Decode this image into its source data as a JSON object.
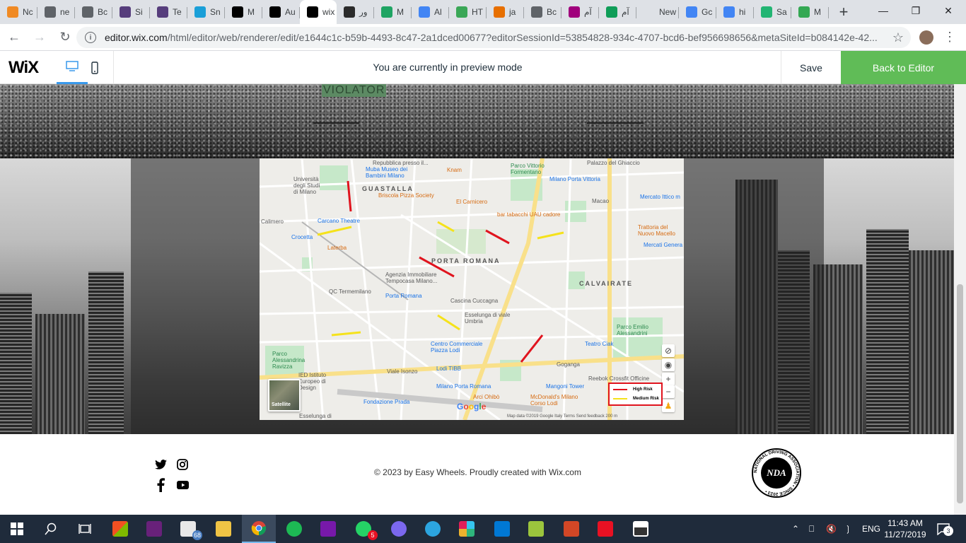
{
  "browser": {
    "tabs": [
      {
        "label": "Nc",
        "color": "#f08a24"
      },
      {
        "label": "ne",
        "color": "#5f6368"
      },
      {
        "label": "Bc",
        "color": "#5f6368"
      },
      {
        "label": "Si",
        "color": "#563d7c"
      },
      {
        "label": "Te",
        "color": "#563d7c"
      },
      {
        "label": "Sn",
        "color": "#1a9fd8"
      },
      {
        "label": "M",
        "color": "#000000"
      },
      {
        "label": "Au",
        "color": "#000000"
      },
      {
        "label": "wix",
        "color": "#000000",
        "active": true
      },
      {
        "label": "ور",
        "color": "#2b2b2b"
      },
      {
        "label": "M",
        "color": "#1fa463"
      },
      {
        "label": "Al",
        "color": "#4285f4"
      },
      {
        "label": "HT",
        "color": "#3aa757"
      },
      {
        "label": "ja",
        "color": "#e76f00"
      },
      {
        "label": "Bc",
        "color": "#5f6368"
      },
      {
        "label": "آم",
        "color": "#a0007c"
      },
      {
        "label": "آم",
        "color": "#0f9d58"
      },
      {
        "label": "New Ta",
        "color": "#dee1e6"
      },
      {
        "label": "Gc",
        "color": "#4285f4"
      },
      {
        "label": "hi",
        "color": "#4285f4"
      },
      {
        "label": "Sa",
        "color": "#22b573"
      },
      {
        "label": "M",
        "color": "#34a853"
      }
    ],
    "new_tab_glyph": "+",
    "url_host": "editor.wix.com",
    "url_path": "/html/editor/web/renderer/edit/e1644c1c-b59b-4493-8c47-2a1dced00677?editorSessionId=53854828-934c-4707-bcd6-bef956698656&metaSiteId=b084142e-42..."
  },
  "wix": {
    "logo": "WiX",
    "preview_message": "You are currently in preview mode",
    "save_label": "Save",
    "back_label": "Back to Editor"
  },
  "page": {
    "banner_text": "VIOLATOR",
    "map": {
      "districts": [
        "GUASTALLA",
        "PORTA ROMANA",
        "CALVAIRATE"
      ],
      "labels": [
        {
          "text": "Università degli Studi di Milano",
          "kind": "plain"
        },
        {
          "text": "Repubblica presso il...",
          "kind": "plain"
        },
        {
          "text": "Muba Museo dei Bambini Milano",
          "kind": "poi"
        },
        {
          "text": "Knam",
          "kind": "orange"
        },
        {
          "text": "Parco Vittorio Formentano",
          "kind": "green"
        },
        {
          "text": "Palazzo del Ghiaccio",
          "kind": "plain"
        },
        {
          "text": "Briscola Pizza Society",
          "kind": "orange"
        },
        {
          "text": "El Carnicero",
          "kind": "orange"
        },
        {
          "text": "Milano Porta Vittoria",
          "kind": "poi"
        },
        {
          "text": "Macao",
          "kind": "plain"
        },
        {
          "text": "Mercato Ittico m",
          "kind": "poi"
        },
        {
          "text": "Calimero",
          "kind": "plain"
        },
        {
          "text": "Carcano Theatre",
          "kind": "poi"
        },
        {
          "text": "bar tabacchi UAU cadore",
          "kind": "orange"
        },
        {
          "text": "Trattoria del Nuovo Macello",
          "kind": "orange"
        },
        {
          "text": "Crocetta",
          "kind": "poi"
        },
        {
          "text": "Laterba",
          "kind": "orange"
        },
        {
          "text": "Mercati Genera",
          "kind": "poi"
        },
        {
          "text": "Agenzia Immobiliare Tempocasa Milano...",
          "kind": "plain"
        },
        {
          "text": "QC Termemilano",
          "kind": "plain"
        },
        {
          "text": "Porta Romana",
          "kind": "poi"
        },
        {
          "text": "Cascina Cuccagna",
          "kind": "plain"
        },
        {
          "text": "Esselunga di viale Umbria",
          "kind": "plain"
        },
        {
          "text": "Parco Emilio Alessandrini",
          "kind": "green"
        },
        {
          "text": "Teatro Ciak",
          "kind": "poi"
        },
        {
          "text": "Centro Commerciale Piazza Lodi",
          "kind": "poi"
        },
        {
          "text": "Parco Alessandrina Ravizza",
          "kind": "green"
        },
        {
          "text": "Goganga",
          "kind": "plain"
        },
        {
          "text": "Lodi TIBB",
          "kind": "poi"
        },
        {
          "text": "Viale Isonzo",
          "kind": "plain"
        },
        {
          "text": "Reebok Crossfit Officine",
          "kind": "plain"
        },
        {
          "text": "IED Istituto Europeo di Design",
          "kind": "plain"
        },
        {
          "text": "Milano Porta Romana",
          "kind": "poi"
        },
        {
          "text": "Mangoni Tower",
          "kind": "poi"
        },
        {
          "text": "Fondazione Prada",
          "kind": "poi"
        },
        {
          "text": "Arci Ohibò",
          "kind": "orange"
        },
        {
          "text": "McDonald's Milano Corso Lodi",
          "kind": "orange"
        },
        {
          "text": "Esselunga di",
          "kind": "plain"
        }
      ],
      "satellite_label": "Satellite",
      "google_logo": "Google",
      "attribution": "Map data ©2019 Google   Italy   Terms   Send feedback   200 m",
      "legend": [
        {
          "label": "High Risk",
          "color": "#e0141e"
        },
        {
          "label": "Medium Risk",
          "color": "#f5e21b"
        }
      ],
      "zoom_in": "+",
      "zoom_out": "−"
    },
    "footer": {
      "copyright": "© 2023 by Easy Wheels. Proudly created with Wix.com",
      "badge_text": "NDA",
      "badge_ring": "NATIONAL DRIVING ASSOCIATION • SINCE 2023 •"
    }
  },
  "taskbar": {
    "mail_badge": "68",
    "whatsapp_badge": "5",
    "lang": "ENG",
    "time": "11:43 AM",
    "date": "11/27/2019",
    "notif_count": "3"
  }
}
